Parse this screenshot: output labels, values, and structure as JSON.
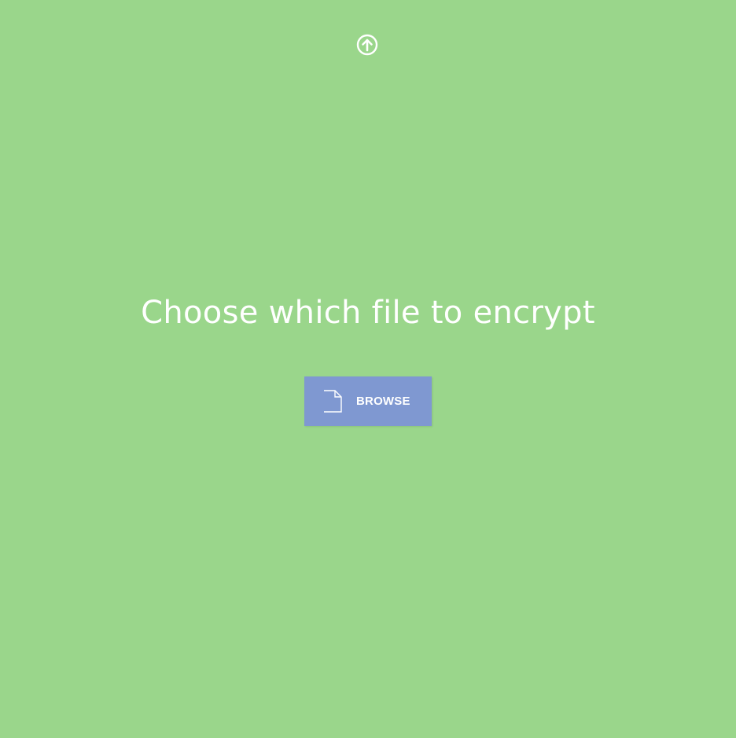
{
  "theme": {
    "background": "#9ad68b",
    "button_color": "#7f98d1",
    "text_color": "#ffffff"
  },
  "header": {
    "upload_icon": "arrow-up-circle-icon"
  },
  "main": {
    "title": "Choose which file to encrypt",
    "browse_button": {
      "label": "BROWSE",
      "icon": "file-icon"
    }
  }
}
